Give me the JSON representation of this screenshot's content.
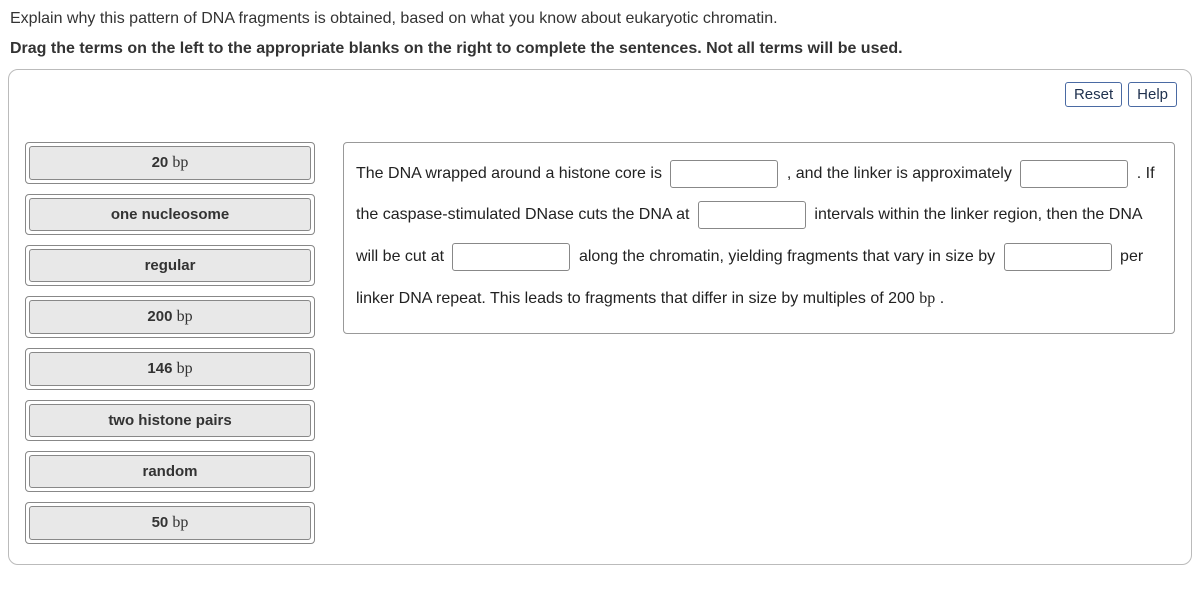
{
  "header": {
    "line1": "Explain why this pattern of DNA fragments is obtained, based on what you know about eukaryotic chromatin.",
    "line2": "Drag the terms on the left to the appropriate blanks on the right to complete the sentences. Not all terms will be used."
  },
  "toolbar": {
    "reset": "Reset",
    "help": "Help"
  },
  "terms": [
    {
      "num": "20",
      "unit": "bp"
    },
    {
      "text": "one nucleosome"
    },
    {
      "text": "regular"
    },
    {
      "num": "200",
      "unit": "bp"
    },
    {
      "num": "146",
      "unit": "bp"
    },
    {
      "text": "two histone pairs"
    },
    {
      "text": "random"
    },
    {
      "num": "50",
      "unit": "bp"
    }
  ],
  "sentence": {
    "s1": "The DNA wrapped around a histone core is ",
    "s2": " , and the linker is approximately ",
    "s3": " . If the caspase-stimulated DNase cuts the DNA at ",
    "s4": " intervals within the linker region, then the DNA will be cut at ",
    "s5": " along the chromatin, yielding fragments that vary in size by ",
    "s6": " per linker DNA repeat. This leads to fragments that differ in size by multiples of ",
    "s7_num": "200",
    "s7_unit": "bp",
    "s8": "."
  }
}
